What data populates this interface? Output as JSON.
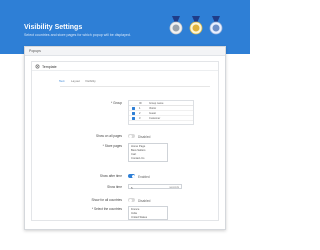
{
  "header": {
    "title": "Visibility Settings",
    "subtitle": "Select countries and store pages for which popup will be displayed."
  },
  "badges": [
    {
      "icon": "medal-badge-icon",
      "color": "#f2f2f2"
    },
    {
      "icon": "medal-badge-icon",
      "color": "#fff7d6"
    },
    {
      "icon": "medal-badge-icon",
      "color": "#e8f0ff"
    }
  ],
  "panel": {
    "topbar_label": "Popups",
    "inner_title": "Template"
  },
  "tabs": [
    {
      "label": "Text",
      "active": true
    },
    {
      "label": "Layout",
      "active": false
    },
    {
      "label": "Visibility",
      "active": false
    }
  ],
  "group": {
    "label": "* Group",
    "headers": {
      "id": "ID",
      "name": "Group name"
    },
    "rows": [
      {
        "id": "1",
        "name": "Visitor",
        "checked": true
      },
      {
        "id": "2",
        "name": "Guest",
        "checked": true
      },
      {
        "id": "3",
        "name": "Customer",
        "checked": true
      }
    ]
  },
  "show_all_pages": {
    "label": "Show on all pages",
    "state": "Disabled",
    "on": false
  },
  "store_pages": {
    "label": "* Store pages",
    "options": [
      "Home Page",
      "Best-Sellers",
      "Cart",
      "Contact-Us"
    ]
  },
  "show_after": {
    "label": "Show after time",
    "state": "Enabled",
    "on": true
  },
  "show_time": {
    "label": "Show time",
    "value": "5",
    "unit": "seconds"
  },
  "show_all_countries": {
    "label": "Show for all countries",
    "state": "Disabled",
    "on": false
  },
  "countries": {
    "label": "* Select the countries",
    "options": [
      "France",
      "India",
      "United States"
    ]
  },
  "colors": {
    "accent": "#2e7fd6",
    "switch_off": "#d9d9d9"
  }
}
